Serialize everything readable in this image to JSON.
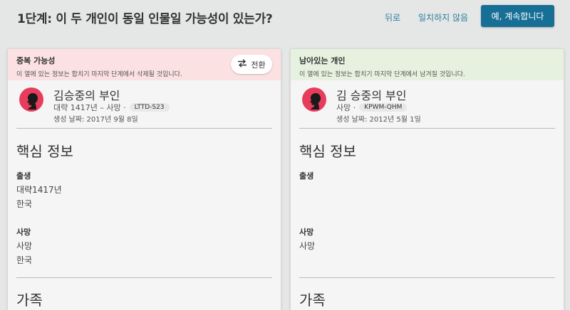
{
  "header": {
    "title": "1단계: 이 두 개인이 동일 인물일 가능성이 있는가?",
    "back_label": "뒤로",
    "nomatch_label": "일치하지 않음",
    "continue_label": "예, 계속합니다"
  },
  "left": {
    "header_title": "중복 가능성",
    "header_sub": "이 열에 있는 정보는 합치기 마지막 단계에서 삭제될 것입니다.",
    "swap_label": "전환",
    "name": "김승중의 부인",
    "meta": "대략 1417년 – 사망 ·",
    "pid": "LTTD-S23",
    "created": "생성 날짜: 2017년 9월 8일",
    "section_core": "핵심 정보",
    "birth_label": "출생",
    "birth_date": "대략1417년",
    "birth_place": "한국",
    "death_label": "사망",
    "death_date": "사망",
    "death_place": "한국",
    "section_family": "가족"
  },
  "right": {
    "header_title": "남아있는 개인",
    "header_sub": "이 열에 있는 정보는 합치기 마지막 단계에서 남겨질 것입니다.",
    "name": "김 승중의 부인",
    "meta": "사망 ·",
    "pid": "KPWM-QHM",
    "created": "생성 날짜: 2012년 5월 1일",
    "section_core": "핵심 정보",
    "birth_label": "출생",
    "death_label": "사망",
    "death_date": "사망",
    "section_family": "가족"
  },
  "colors": {
    "accent": "#176f96",
    "link": "#2b7f9e",
    "left_header_bg": "#fbe1e1",
    "right_header_bg": "#e6f2df",
    "avatar": "#e73c5c"
  },
  "icons": {
    "swap": "swap-arrows-icon",
    "avatar": "female-silhouette-icon"
  }
}
